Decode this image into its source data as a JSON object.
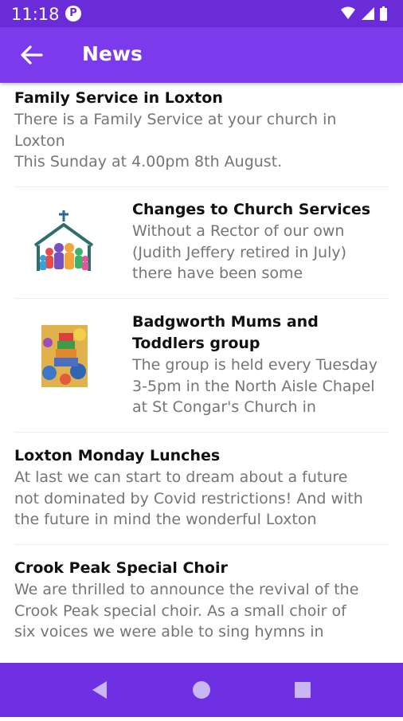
{
  "status": {
    "time": "11:18",
    "app_badge": "P"
  },
  "header": {
    "title": "News"
  },
  "news": [
    {
      "title": "Family Service in Loxton",
      "body": "There is a Family Service at your church in\nLoxton\nThis Sunday at 4.00pm 8th August."
    },
    {
      "title": "Changes to Church Services",
      "body": "Without a Rector of our own\n(Judith Jeffery retired in July)\nthere have been some"
    },
    {
      "title": "Badgworth Mums and Toddlers group",
      "body": "The group is held every Tuesday\n3-5pm in the North Aisle Chapel\nat St Congar's Church in"
    },
    {
      "title": "Loxton Monday Lunches",
      "body": "At last we can start to dream about a future\nnot dominated by Covid restrictions! And with\nthe future in mind the wonderful Loxton"
    },
    {
      "title": "Crook Peak Special Choir",
      "body": "We are thrilled to announce the revival of the\nCrook Peak special choir. As a small choir of\nsix voices we were able to sing hymns in"
    }
  ],
  "icons": {
    "back": "arrow-back-icon",
    "wifi": "wifi-icon",
    "signal": "cell-signal-icon",
    "battery": "battery-icon",
    "nav_back": "nav-back-icon",
    "nav_home": "nav-home-icon",
    "nav_recents": "nav-recents-icon"
  },
  "colors": {
    "status_bar": "#6a2bd9",
    "app_bar": "#7c3aed",
    "nav_bar": "#6f2fe3",
    "title_text": "#111111",
    "body_text": "#757575"
  }
}
